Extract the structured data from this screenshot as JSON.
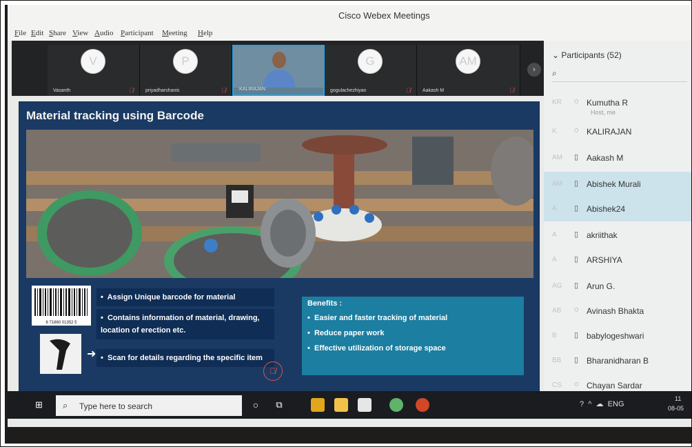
{
  "window": {
    "title": "Cisco Webex Meetings"
  },
  "menu": [
    "File",
    "Edit",
    "Share",
    "View",
    "Audio",
    "Participant",
    "Meeting",
    "Help"
  ],
  "strip": {
    "tiles": [
      {
        "initials": "V",
        "name": "Vasanth",
        "icons": "🎙̸"
      },
      {
        "initials": "P",
        "name": "priyadharshanis",
        "icons": "🎙̸"
      },
      {
        "initials": "",
        "name": "KALIRAJAN",
        "icons": ""
      },
      {
        "initials": "G",
        "name": "gogulachezhiyan",
        "icons": "🎙̸"
      },
      {
        "initials": "AM",
        "name": "Aakash M",
        "icons": "🎙̸"
      }
    ],
    "next_glyph": "›"
  },
  "slide": {
    "title": "Material tracking using Barcode",
    "left_bullets": [
      "Assign Unique barcode for material",
      "Contains information of material, drawing, location of erection etc.",
      "Scan for details regarding the specific item"
    ],
    "benefits_title": "Benefits :",
    "benefits": [
      "Easier and faster tracking of material",
      "Reduce paper work",
      "Effective utilization of storage space"
    ],
    "barcode_number": "6 71860 01352 5",
    "arrow_glyph": "➜",
    "bullet_glyph": "•"
  },
  "participants": {
    "header": "Participants (52)",
    "search_glyph": "⌕",
    "list": [
      {
        "initials": "KR",
        "icon": "◌",
        "name": "Kumutha R",
        "role": "Host, me",
        "selected": false
      },
      {
        "initials": "K",
        "icon": "◌",
        "name": "KALIRAJAN",
        "role": "",
        "selected": false
      },
      {
        "initials": "AM",
        "icon": "▯",
        "name": "Aakash M",
        "role": "",
        "selected": false
      },
      {
        "initials": "AM",
        "icon": "▯",
        "name": "Abishek Murali",
        "role": "",
        "selected": true
      },
      {
        "initials": "A",
        "icon": "▯",
        "name": "Abishek24",
        "role": "",
        "selected": true
      },
      {
        "initials": "A",
        "icon": "▯",
        "name": "akriithak",
        "role": "",
        "selected": false
      },
      {
        "initials": "A",
        "icon": "▯",
        "name": "ARSHIYA",
        "role": "",
        "selected": false
      },
      {
        "initials": "AG",
        "icon": "▯",
        "name": "Arun G.",
        "role": "",
        "selected": false
      },
      {
        "initials": "AB",
        "icon": "◌",
        "name": "Avinash Bhakta",
        "role": "",
        "selected": false
      },
      {
        "initials": "B",
        "icon": "▯",
        "name": "babylogeshwari",
        "role": "",
        "selected": false
      },
      {
        "initials": "BB",
        "icon": "▯",
        "name": "Bharanidharan B",
        "role": "",
        "selected": false
      },
      {
        "initials": "CS",
        "icon": "◌",
        "name": "Chayan Sardar",
        "role": "",
        "selected": false
      }
    ]
  },
  "taskbar": {
    "start_glyph": "⊞",
    "search_placeholder": "Type here to search",
    "search_glyph": "⌕",
    "tray_text": "ENG",
    "time_text": "11",
    "date_text": "08-05"
  }
}
